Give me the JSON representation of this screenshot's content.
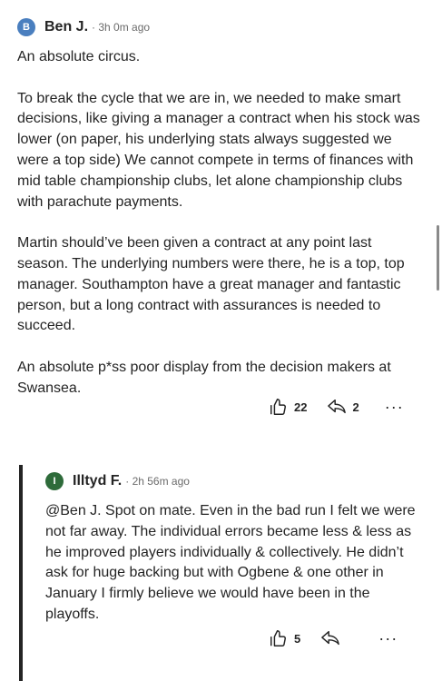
{
  "comments": [
    {
      "avatar_letter": "B",
      "avatar_color": "#4a7fbf",
      "author": "Ben J.",
      "time": "· 3h 0m ago",
      "paragraphs": [
        "An absolute circus.",
        "To break the cycle that we are in, we needed to make smart decisions, like giving a manager a contract when his stock was lower (on paper, his underlying stats always suggested we were a top side) We cannot compete in terms of finances with mid table championship clubs, let alone championship clubs with parachute payments.",
        "Martin should’ve been given a contract at any point last season. The underlying numbers were there, he is a top, top manager. Southampton have a great manager and fantastic person, but a long contract with assurances is needed to succeed.",
        "An absolute p*ss poor display from the decision makers at Swansea."
      ],
      "likes": "22",
      "replies": "2",
      "more_icon": "more-dots-icon"
    },
    {
      "avatar_letter": "I",
      "avatar_color": "#2e6b3a",
      "author": "Illtyd F.",
      "time": "· 2h 56m ago",
      "paragraphs": [
        "@Ben J. Spot on mate. Even in the bad run I felt we were not far away. The individual errors became less & less as he improved players individually & collectively. He didn’t ask for huge backing but with Ogbene & one other in January I firmly believe we would have been in the playoffs."
      ],
      "likes": "5",
      "replies": "",
      "more_icon": "more-dots-icon"
    }
  ]
}
